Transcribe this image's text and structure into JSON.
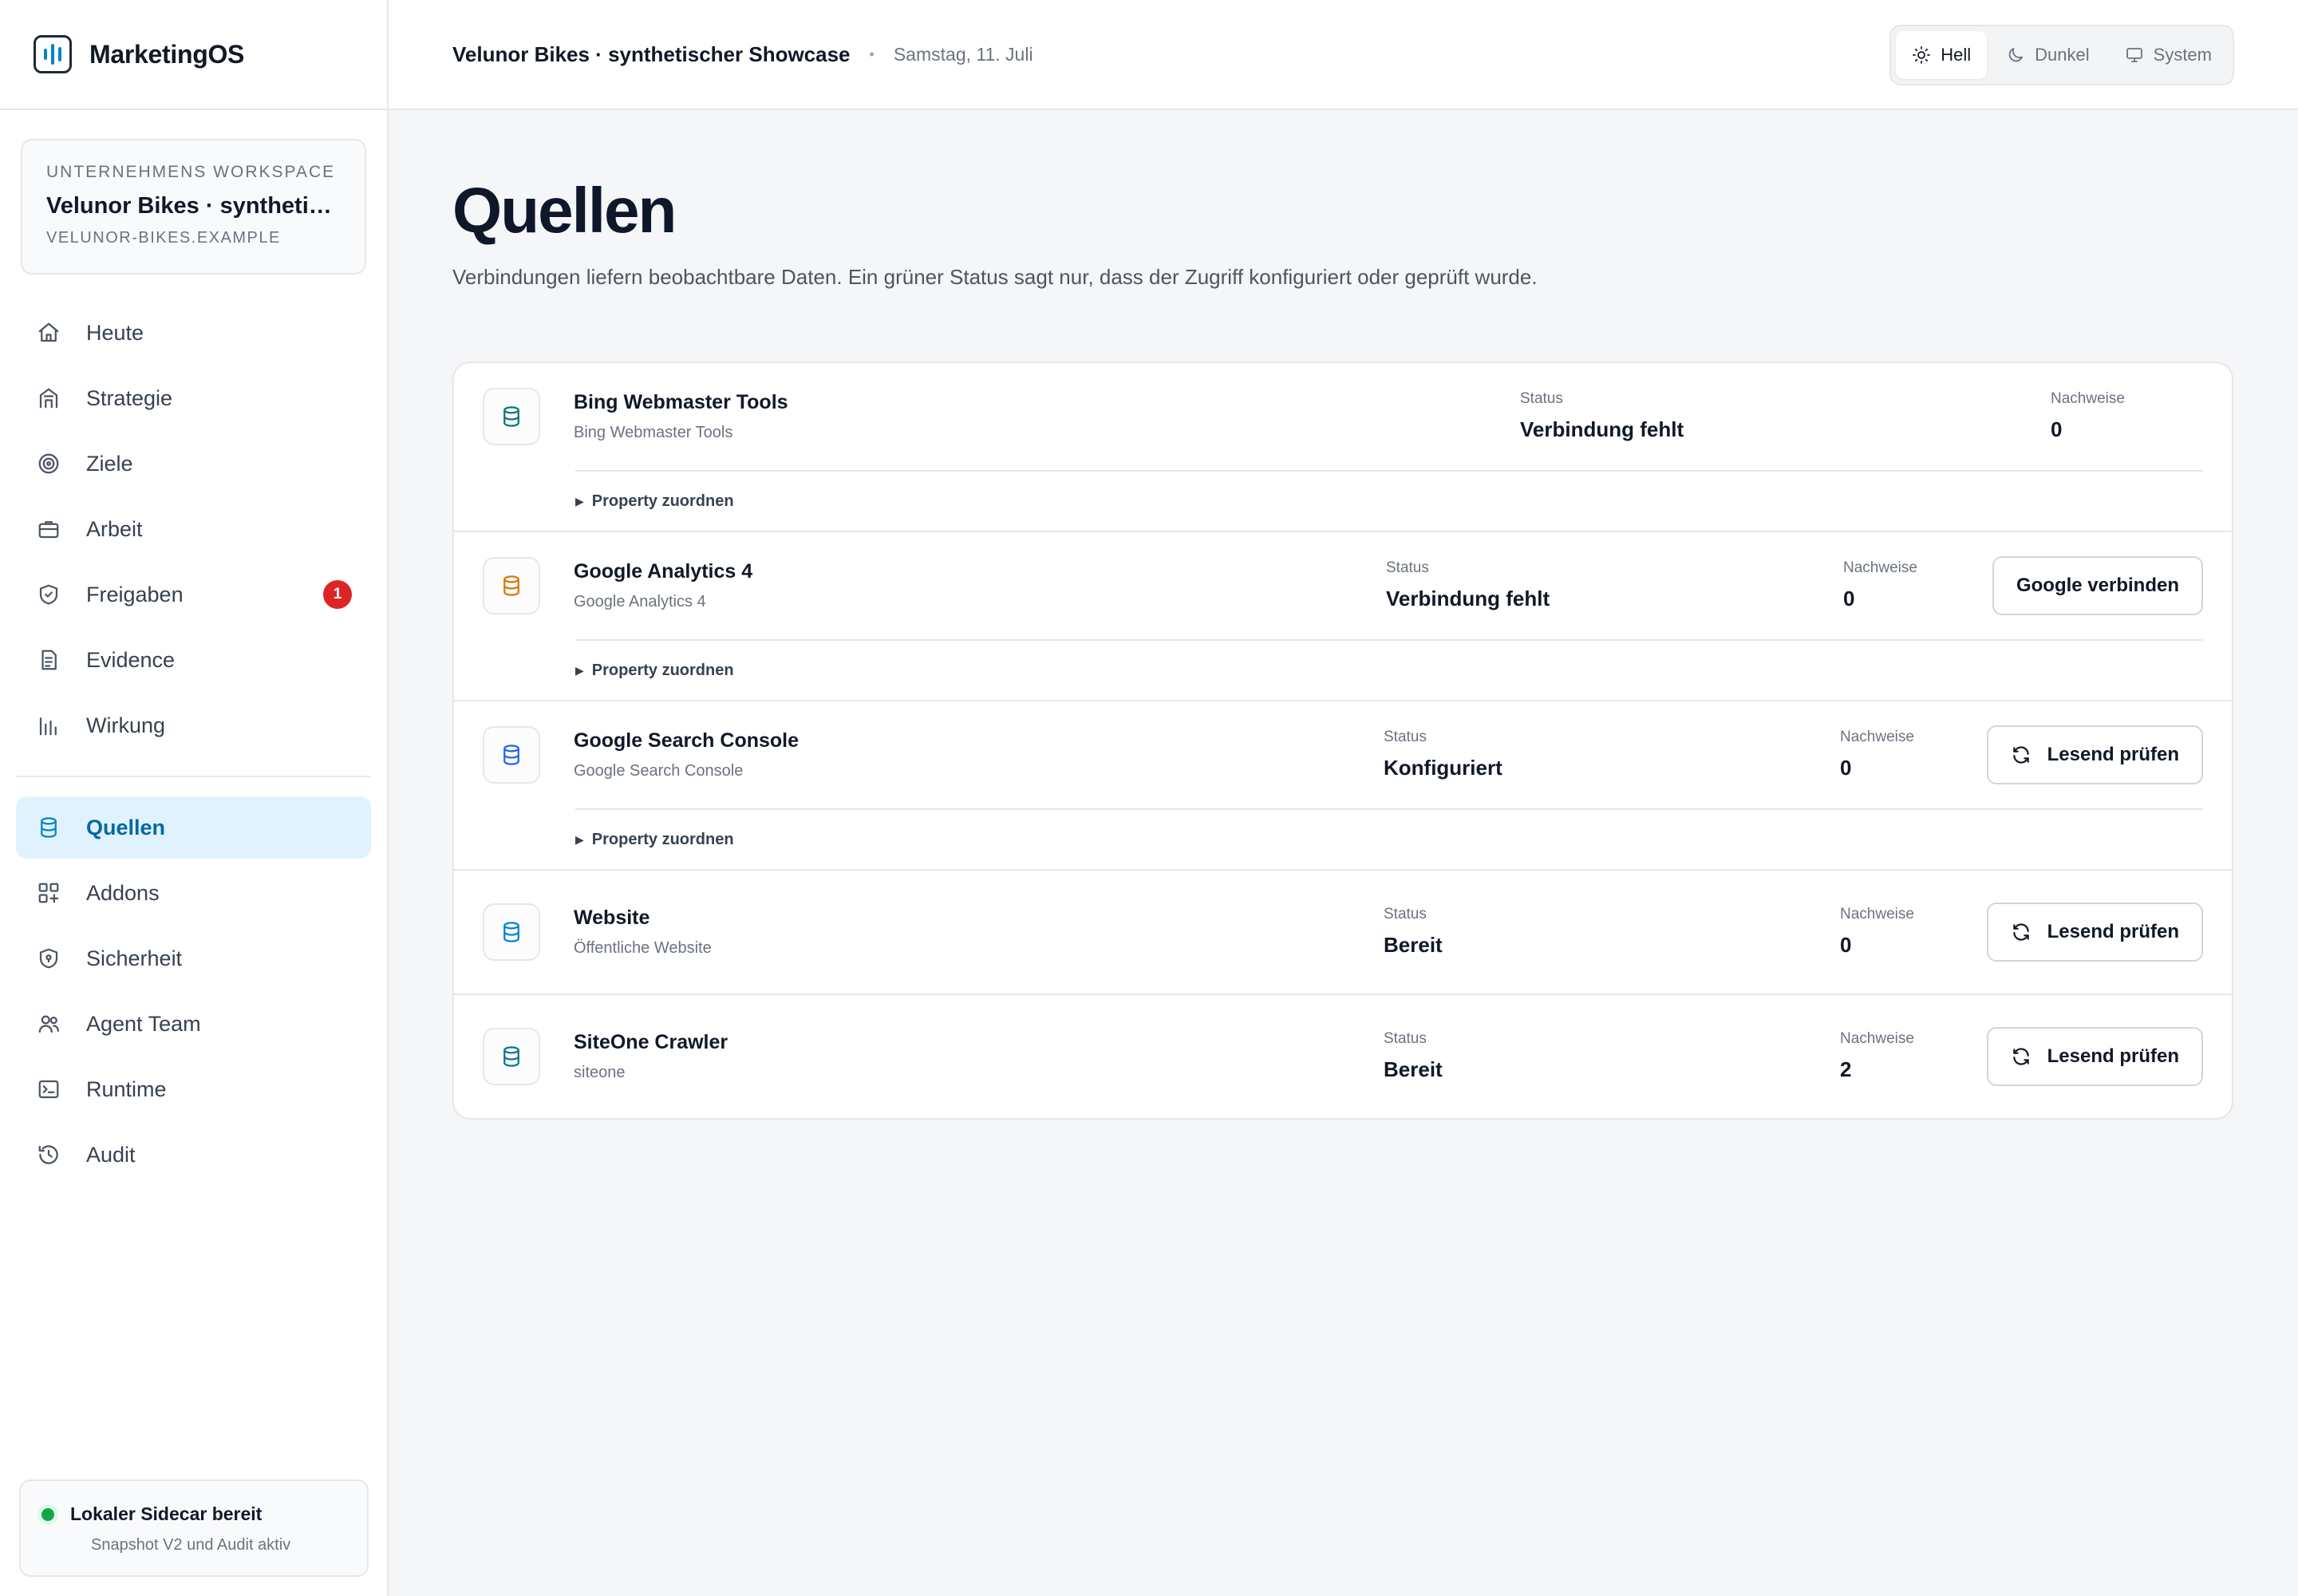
{
  "app": {
    "name": "MarketingOS"
  },
  "workspace": {
    "kicker": "UNTERNEHMENS WORKSPACE",
    "name": "Velunor Bikes · synthetisch…",
    "domain": "VELUNOR-BIKES.EXAMPLE"
  },
  "nav": {
    "items": [
      {
        "label": "Heute",
        "icon": "home-icon"
      },
      {
        "label": "Strategie",
        "icon": "building-icon"
      },
      {
        "label": "Ziele",
        "icon": "target-icon"
      },
      {
        "label": "Arbeit",
        "icon": "briefcase-icon"
      },
      {
        "label": "Freigaben",
        "icon": "shield-check-icon",
        "badge": "1"
      },
      {
        "label": "Evidence",
        "icon": "document-icon"
      },
      {
        "label": "Wirkung",
        "icon": "bar-chart-icon"
      }
    ],
    "items2": [
      {
        "label": "Quellen",
        "icon": "database-icon",
        "active": true
      },
      {
        "label": "Addons",
        "icon": "grid-plus-icon"
      },
      {
        "label": "Sicherheit",
        "icon": "shield-lock-icon"
      },
      {
        "label": "Agent Team",
        "icon": "users-icon"
      },
      {
        "label": "Runtime",
        "icon": "terminal-icon"
      },
      {
        "label": "Audit",
        "icon": "history-icon"
      }
    ]
  },
  "sidecar": {
    "title": "Lokaler Sidecar bereit",
    "subtitle": "Snapshot V2 und Audit aktiv",
    "status_color": "#16a34a"
  },
  "topbar": {
    "title": "Velunor Bikes · synthetischer Showcase",
    "separator": "•",
    "date": "Samstag, 11. Juli",
    "theme": {
      "options": [
        {
          "label": "Hell",
          "icon": "sun-icon",
          "active": true
        },
        {
          "label": "Dunkel",
          "icon": "moon-icon"
        },
        {
          "label": "System",
          "icon": "monitor-icon"
        }
      ]
    }
  },
  "page": {
    "title": "Quellen",
    "description": "Verbindungen liefern beobachtbare Daten. Ein grüner Status sagt nur, dass der Zugriff konfiguriert oder geprüft wurde."
  },
  "sources": [
    {
      "name": "Bing Webmaster Tools",
      "subtitle": "Bing Webmaster Tools",
      "status_label": "Status",
      "status": "Verbindung fehlt",
      "evidence_label": "Nachweise",
      "evidence": "0",
      "icon_color": "#0f766e",
      "expand_label": "Property zuordnen"
    },
    {
      "name": "Google Analytics 4",
      "subtitle": "Google Analytics 4",
      "status_label": "Status",
      "status": "Verbindung fehlt",
      "evidence_label": "Nachweise",
      "evidence": "0",
      "icon_color": "#d97706",
      "action": "Google verbinden",
      "expand_label": "Property zuordnen"
    },
    {
      "name": "Google Search Console",
      "subtitle": "Google Search Console",
      "status_label": "Status",
      "status": "Konfiguriert",
      "evidence_label": "Nachweise",
      "evidence": "0",
      "icon_color": "#2563eb",
      "action": "Lesend prüfen",
      "expand_label": "Property zuordnen"
    },
    {
      "name": "Website",
      "subtitle": "Öffentliche Website",
      "status_label": "Status",
      "status": "Bereit",
      "evidence_label": "Nachweise",
      "evidence": "0",
      "icon_color": "#0284c7",
      "action": "Lesend prüfen"
    },
    {
      "name": "SiteOne Crawler",
      "subtitle": "siteone",
      "status_label": "Status",
      "status": "Bereit",
      "evidence_label": "Nachweise",
      "evidence": "2",
      "icon_color": "#0e7490",
      "action": "Lesend prüfen"
    }
  ],
  "colors": {
    "accent": "#0284c7",
    "active_nav_bg": "#e0f2fe",
    "badge": "#dc2626"
  }
}
